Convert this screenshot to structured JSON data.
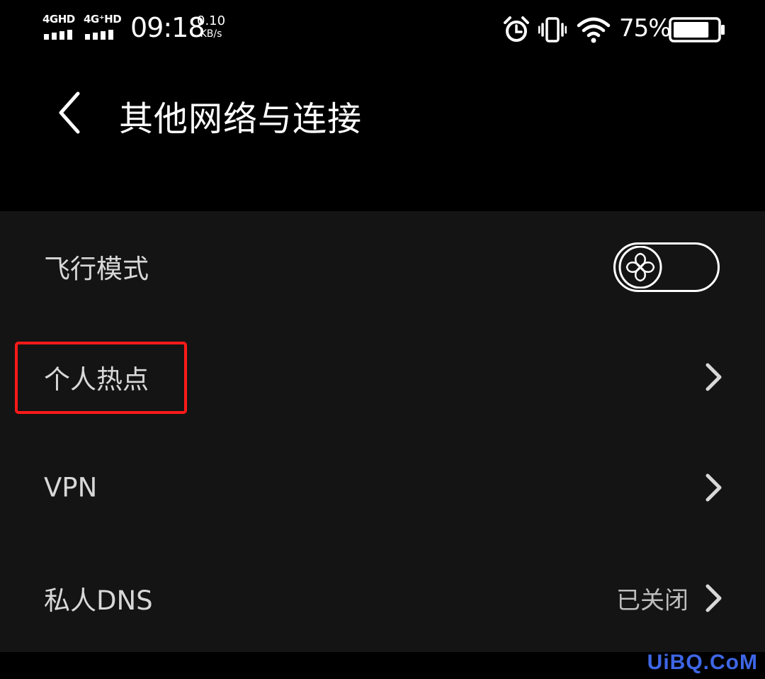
{
  "status_bar": {
    "signal1_label": "4GHD",
    "signal2_label": "4G⁺HD",
    "time": "09:18",
    "net_speed_value": "0.10",
    "net_speed_unit": "KB/s",
    "battery_percent": "75%",
    "battery_level": 0.82,
    "icons": [
      "signal-icon",
      "signal-icon",
      "alarm-icon",
      "vibrate-icon",
      "wifi-icon",
      "battery-icon"
    ]
  },
  "header": {
    "back_icon": "back-arrow-icon",
    "title": "其他网络与连接"
  },
  "settings": {
    "airplane_mode": {
      "label": "飞行模式",
      "toggle_on": false,
      "knob_icon": "clover-icon"
    },
    "hotspot": {
      "label": "个人热点",
      "chevron_icon": "chevron-right-icon"
    },
    "vpn": {
      "label": "VPN",
      "chevron_icon": "chevron-right-icon"
    },
    "private_dns": {
      "label": "私人DNS",
      "value": "已关闭",
      "chevron_icon": "chevron-right-icon"
    }
  },
  "annotation": {
    "highlight_color": "#ff1a1a"
  },
  "watermark": {
    "text": "UiBQ.CoM",
    "color": "#3e66e6"
  },
  "colors": {
    "background": "#000000",
    "list_background": "#141414",
    "text": "#d8d8d8"
  }
}
